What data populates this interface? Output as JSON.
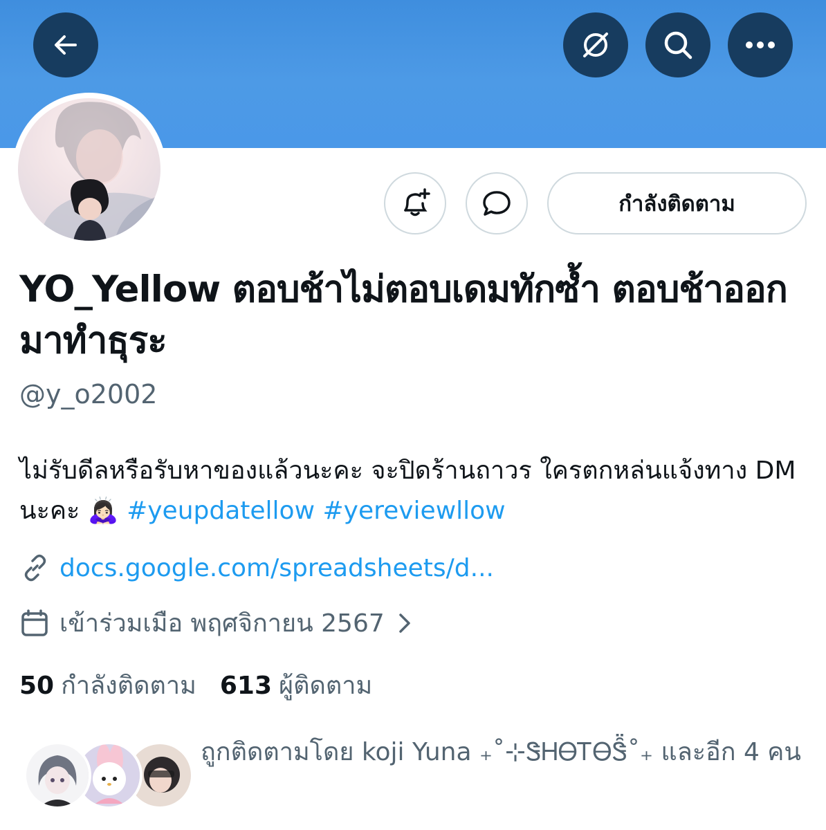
{
  "header": {
    "back_icon": "arrow-left-icon",
    "grok_icon": "grok-icon",
    "search_icon": "search-icon",
    "more_icon": "more-icon"
  },
  "actions": {
    "notify_icon": "bell-plus-icon",
    "message_icon": "message-bubble-icon",
    "following_label": "กำลังติดตาม"
  },
  "profile": {
    "display_name": "YO_Yellow ตอบช้าไม่ตอบเดมทักซ้ำ ตอบช้าออกมาทำธุระ",
    "handle": "@y_o2002",
    "bio_text": "ไม่รับดีลหรือรับหาของแล้วนะคะ จะปิดร้านถาวร ใครตกหล่นแจ้งทาง DM นะคะ 🙇🏻‍♀️ ",
    "hashtag_1": "#yeupdatellow",
    "hashtag_2": "#yereviewllow",
    "link": "docs.google.com/spreadsheets/d...",
    "joined": "เข้าร่วมเมือ พฤศจิกายน 2567"
  },
  "stats": {
    "following_count": "50",
    "following_label": "กำลังติดตาม",
    "followers_count": "613",
    "followers_label": "ผู้ติดตาม"
  },
  "followed_by": {
    "text": "ถูกติดตามโดย koji Yuna ₊˚⊹ᏕᎻᎾᎢᎾᏕ̑̈˚₊ และอีก 4 คน"
  },
  "colors": {
    "banner": "#4a98e8",
    "header_button": "#173c5f",
    "link": "#1d9bf0",
    "secondary_text": "#536471"
  }
}
